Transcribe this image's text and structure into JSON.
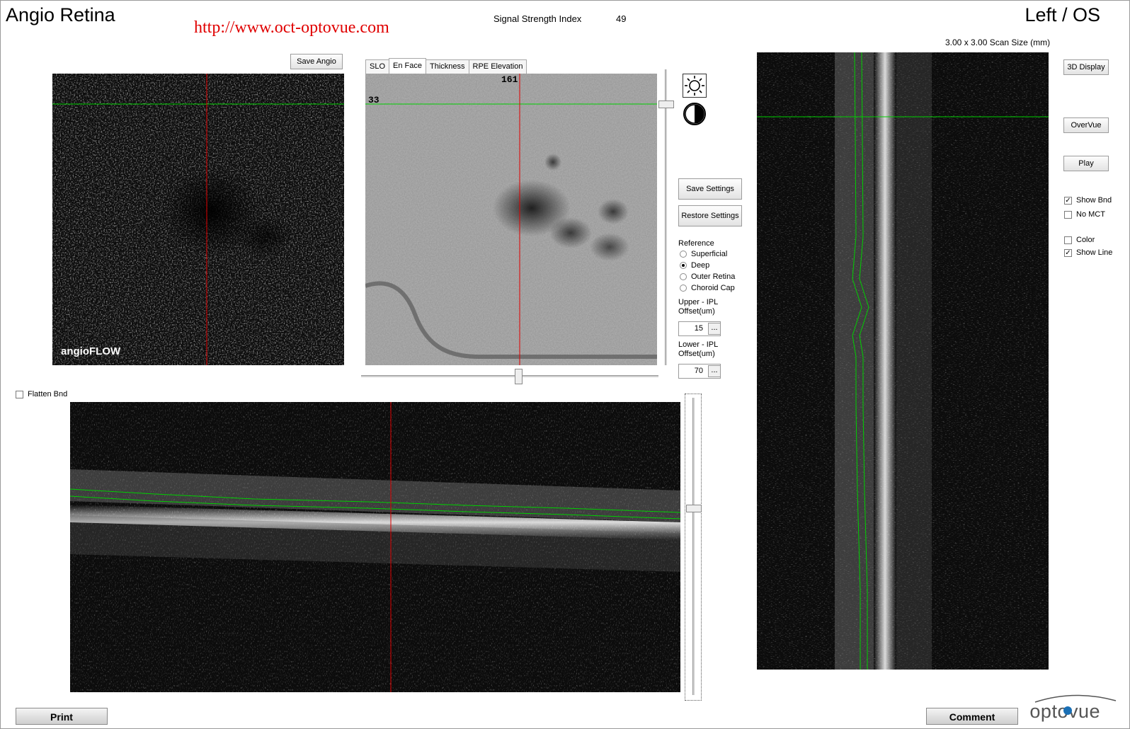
{
  "header": {
    "title": "Angio Retina",
    "url": "http://www.oct-optovue.com",
    "signal_strength_label": "Signal Strength Index",
    "signal_strength_value": "49",
    "eye": "Left / OS",
    "scan_size": "3.00 x 3.00 Scan Size (mm)"
  },
  "angio": {
    "save_label": "Save Angio",
    "watermark": "angioFLOW"
  },
  "tabs": [
    {
      "label": "SLO",
      "active": false
    },
    {
      "label": "En Face",
      "active": true
    },
    {
      "label": "Thickness",
      "active": false
    },
    {
      "label": "RPE Elevation",
      "active": false
    }
  ],
  "enface": {
    "x_readout": "161",
    "y_readout": "33"
  },
  "settings": {
    "brightness_icon": "sun-icon",
    "contrast_icon": "contrast-icon",
    "save_label": "Save Settings",
    "restore_label": "Restore Settings",
    "reference_label": "Reference",
    "reference_options": [
      {
        "label": "Superficial",
        "selected": false
      },
      {
        "label": "Deep",
        "selected": true
      },
      {
        "label": "Outer Retina",
        "selected": false
      },
      {
        "label": "Choroid Cap",
        "selected": false
      }
    ],
    "upper_label_1": "Upper - IPL",
    "upper_label_2": "Offset(um)",
    "upper_value": "15",
    "lower_label_1": "Lower - IPL",
    "lower_label_2": "Offset(um)",
    "lower_value": "70",
    "dots": "..."
  },
  "flatten_label": "Flatten Bnd",
  "right_panel": {
    "display3d_label": "3D Display",
    "overvue_label": "OverVue",
    "play_label": "Play",
    "checks": [
      {
        "label": "Show Bnd",
        "checked": true
      },
      {
        "label": "No MCT",
        "checked": false
      },
      {
        "label": "Color",
        "checked": false
      },
      {
        "label": "Show Line",
        "checked": true
      }
    ]
  },
  "footer": {
    "print_label": "Print",
    "comment_label": "Comment",
    "logo": "optovue"
  },
  "colors": {
    "cursor_red": "#e00000",
    "boundary_green": "#00d000",
    "url_red": "#e00000"
  }
}
